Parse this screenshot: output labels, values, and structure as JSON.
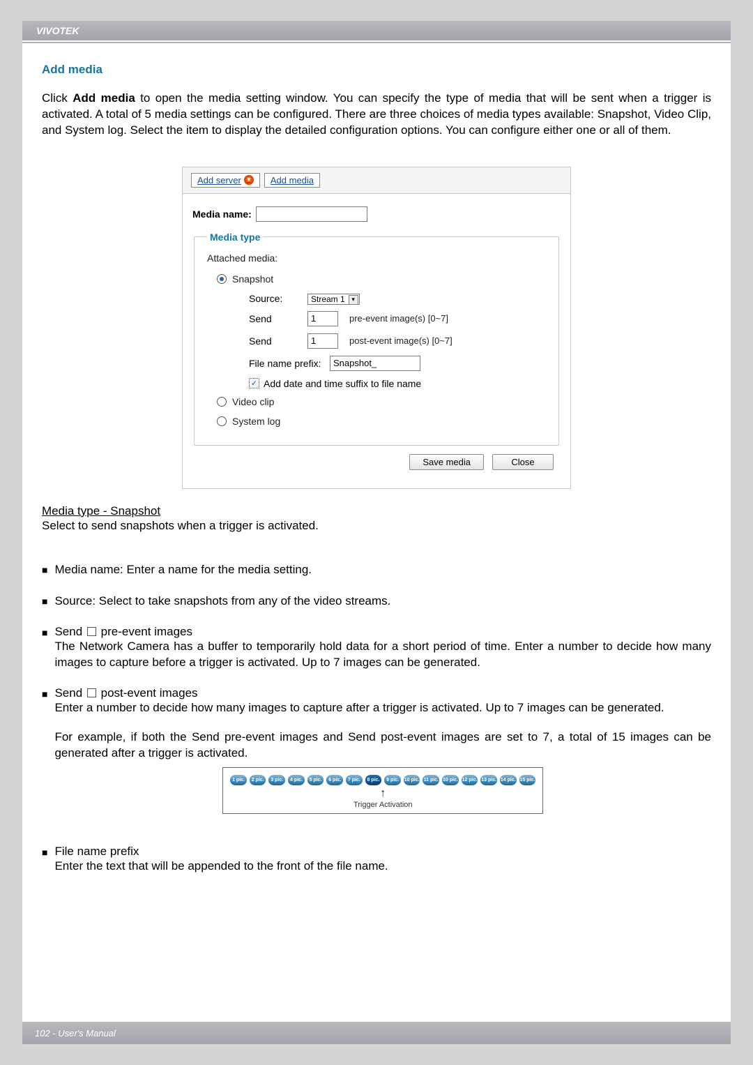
{
  "header": {
    "brand": "VIVOTEK"
  },
  "section": {
    "title": "Add media"
  },
  "intro": {
    "text_prefix": "Click ",
    "text_bold": "Add media",
    "text_suffix": " to open the media setting window. You can specify the type of media that will be sent when a trigger is activated. A total of 5 media settings can be configured. There are three choices of media types available: Snapshot, Video Clip, and System log. Select the item to display the detailed configuration options. You can configure either one or all of them."
  },
  "dialog": {
    "tabs": {
      "add_server": "Add server",
      "add_media": "Add media"
    },
    "media_name_label": "Media name:",
    "media_name_value": "",
    "fieldset_legend": "Media type",
    "attached_label": "Attached media:",
    "snapshot": {
      "label": "Snapshot",
      "source_label": "Source:",
      "source_value": "Stream 1",
      "send_label": "Send",
      "pre_value": "1",
      "pre_suffix": "pre-event image(s) [0~7]",
      "post_value": "1",
      "post_suffix": "post-event image(s) [0~7]",
      "prefix_label": "File name prefix:",
      "prefix_value": "Snapshot_",
      "add_date_label": "Add date and time suffix to file name"
    },
    "video_clip_label": "Video clip",
    "system_log_label": "System log",
    "buttons": {
      "save": "Save media",
      "close": "Close"
    }
  },
  "subtitle": "Media type - Snapshot",
  "subtitle_desc": "Select to send snapshots when a trigger is activated.",
  "bullets": {
    "b1": "Media name: Enter a name for the media setting.",
    "b2": "Source: Select to take snapshots from any of the video streams.",
    "b3_lead": "Send ",
    "b3_tail": " pre-event images",
    "b3_body": "The Network Camera has a buffer to temporarily hold data for a short period of time. Enter a number to decide how many images to capture before a trigger is activated. Up to 7 images can be generated.",
    "b4_lead": "Send ",
    "b4_tail": " post-event images",
    "b4_body1": "Enter a number to decide how many images to capture after a trigger is activated. Up to 7 images can be generated.",
    "b4_body2": "For example, if both the Send pre-event images and Send post-event images are set to 7, a total of 15 images can be generated after a trigger is activated.",
    "b5_head": "File name prefix",
    "b5_body": "Enter the text that will be appended to the front of the file name."
  },
  "timeline": {
    "labels": [
      "1 pic.",
      "2 pic.",
      "3 pic.",
      "4 pic.",
      "5 pic.",
      "6 pic.",
      "7 pic.",
      "8 pic.",
      "9 pic.",
      "10 pic.",
      "11 pic.",
      "10 pic.",
      "12 pic.",
      "13 pic.",
      "14 pic.",
      "15 pic."
    ],
    "center_index": 7,
    "caption": "Trigger Activation"
  },
  "footer": {
    "text": "102 - User's Manual"
  }
}
